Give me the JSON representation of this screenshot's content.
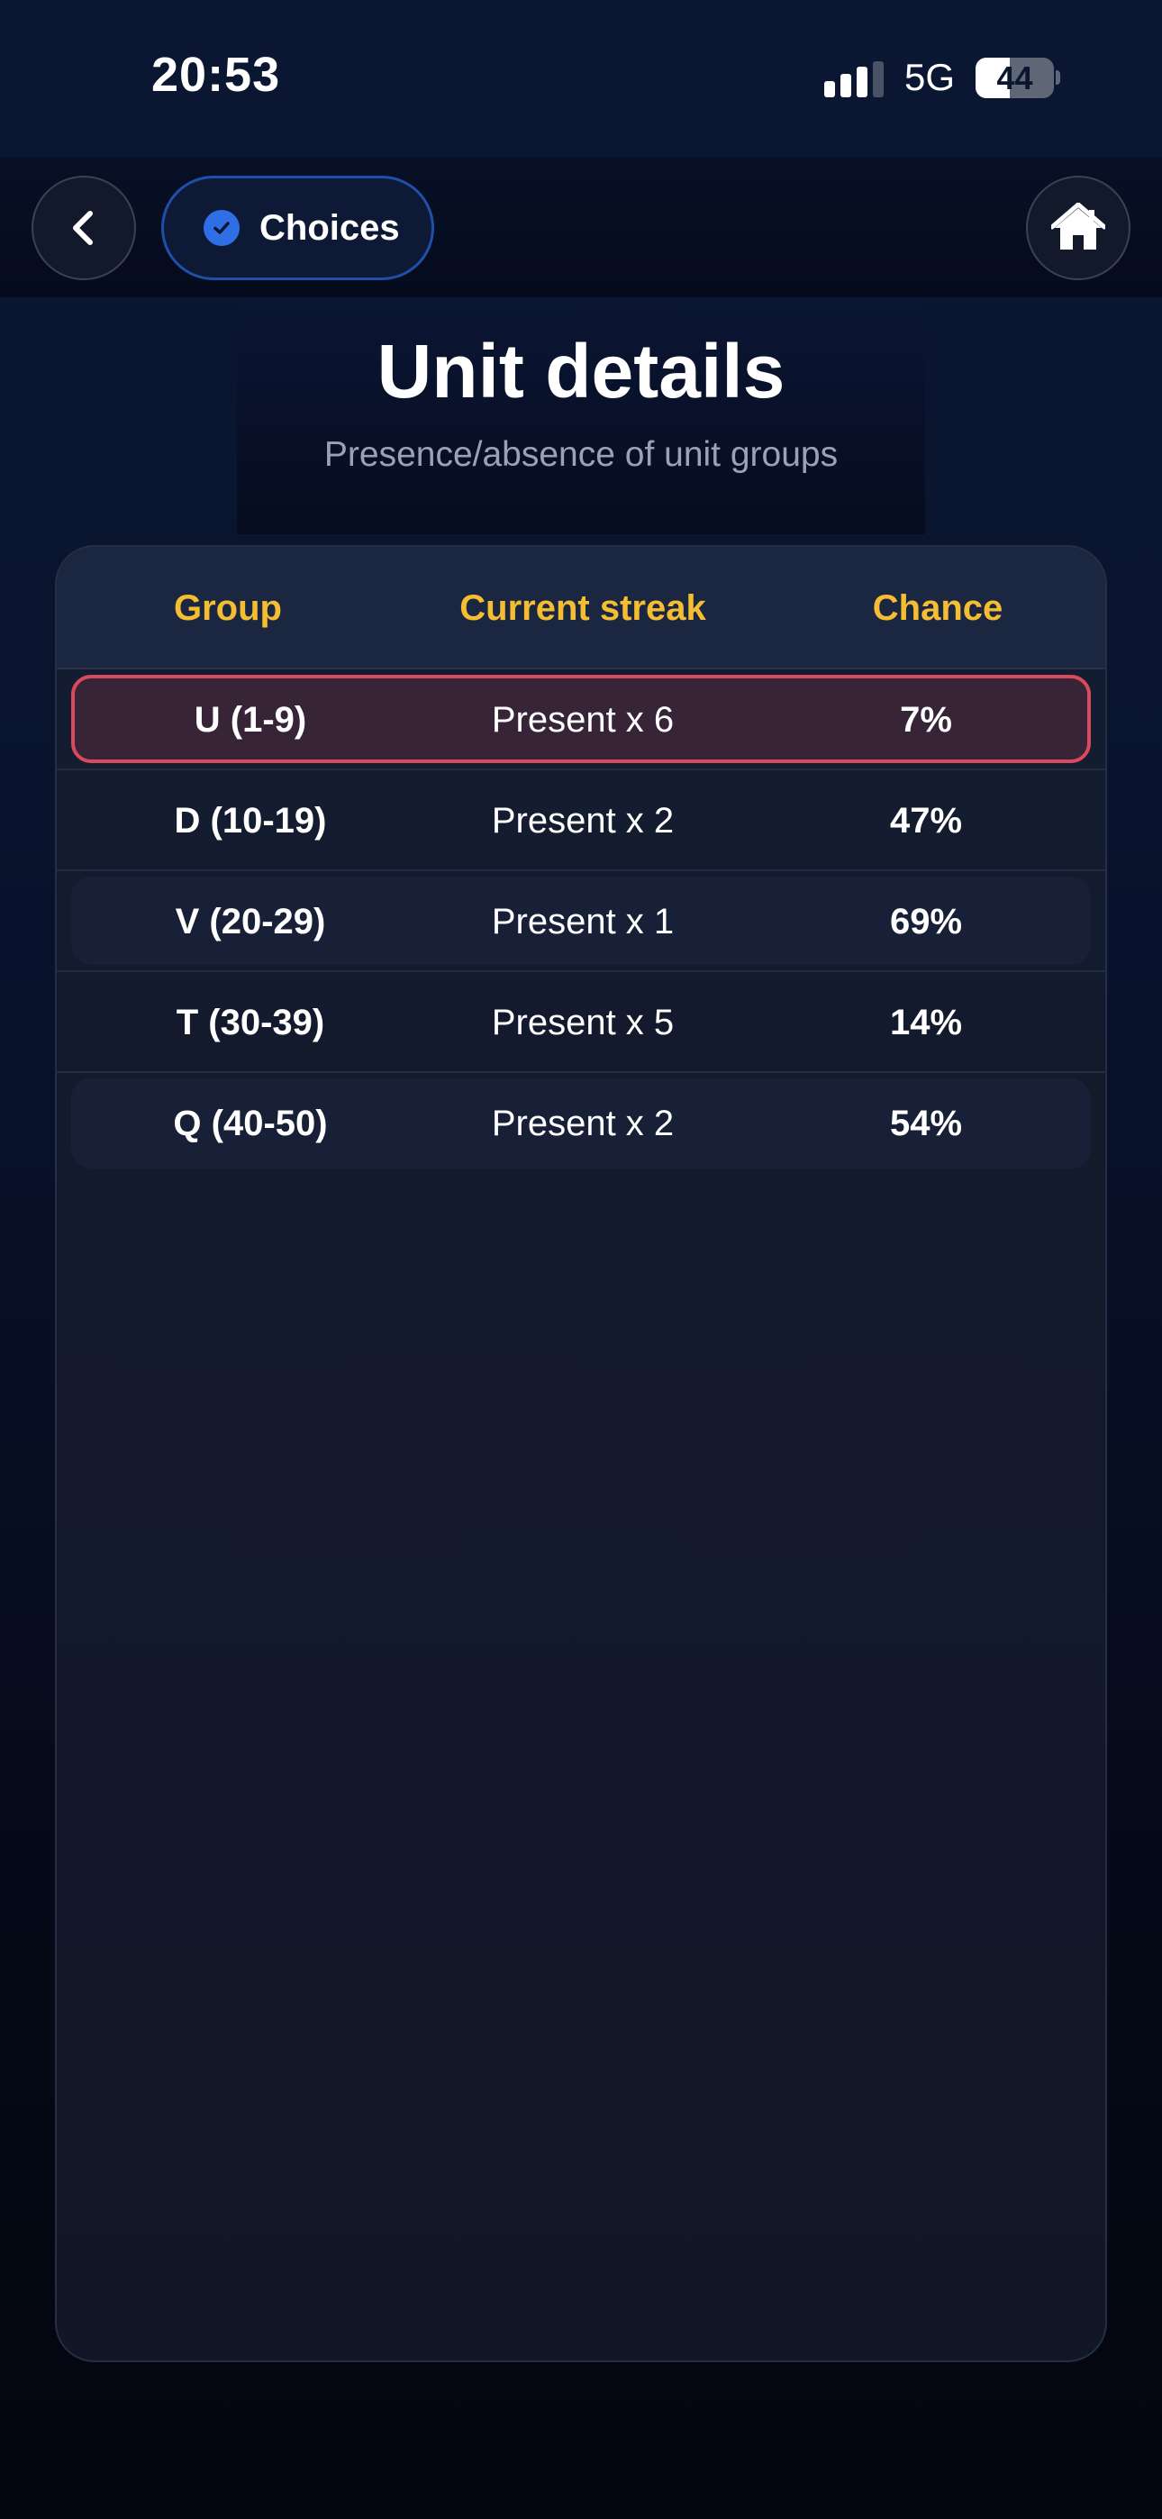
{
  "status_bar": {
    "time": "20:53",
    "network": "5G",
    "battery_level": "44",
    "battery_fraction": 0.44,
    "signal_bars_active": 3,
    "signal_bars_total": 4
  },
  "nav": {
    "back_icon": "chevron-left-icon",
    "choices_label": "Choices",
    "choices_icon": "check-circle-icon",
    "home_icon": "home-icon"
  },
  "header": {
    "title": "Unit details",
    "subtitle": "Presence/absence of unit groups"
  },
  "table": {
    "columns": [
      "Group",
      "Current streak",
      "Chance"
    ],
    "rows": [
      {
        "group": "U (1-9)",
        "streak": "Present x 6",
        "chance": "7%"
      },
      {
        "group": "D (10-19)",
        "streak": "Present x 2",
        "chance": "47%"
      },
      {
        "group": "V (20-29)",
        "streak": "Present x 1",
        "chance": "69%"
      },
      {
        "group": "T (30-39)",
        "streak": "Present x 5",
        "chance": "14%"
      },
      {
        "group": "Q (40-50)",
        "streak": "Present x 2",
        "chance": "54%"
      }
    ],
    "highlighted_row": 0
  },
  "colors": {
    "accent_yellow": "#f5bd32",
    "accent_blue": "#2f6fe6",
    "highlight_red": "#d94a5e"
  }
}
